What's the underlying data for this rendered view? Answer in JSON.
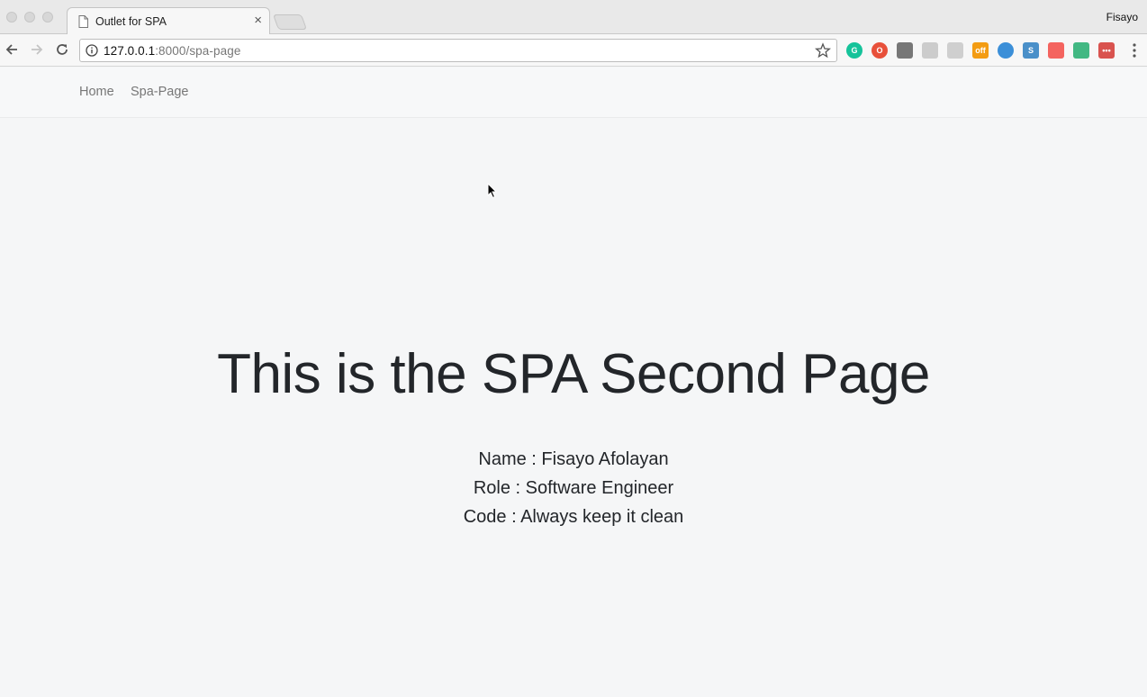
{
  "browser": {
    "tab_title": "Outlet for SPA",
    "tab_close": "×",
    "profile_name": "Fisayo",
    "url_host": "127.0.0.1",
    "url_rest": ":8000/spa-page",
    "extensions": [
      {
        "icon": "grammarly-icon",
        "color": "#15c39a",
        "glyph": "G"
      },
      {
        "icon": "opera-icon",
        "color": "#e8503a",
        "glyph": "O"
      },
      {
        "icon": "shield-icon",
        "color": "#777777",
        "glyph": ""
      },
      {
        "icon": "puzzle-icon",
        "color": "#cccccc",
        "glyph": ""
      },
      {
        "icon": "frame-icon",
        "color": "#cfcfcf",
        "glyph": ""
      },
      {
        "icon": "offline-icon",
        "color": "#f39c12",
        "glyph": "off"
      },
      {
        "icon": "globe-icon",
        "color": "#3b8fd8",
        "glyph": ""
      },
      {
        "icon": "s-icon",
        "color": "#4a90c9",
        "glyph": "S"
      },
      {
        "icon": "laravel-icon",
        "color": "#f4645f",
        "glyph": ""
      },
      {
        "icon": "vue-icon",
        "color": "#42b883",
        "glyph": ""
      },
      {
        "icon": "lastpass-icon",
        "color": "#d9534f",
        "glyph": "•••"
      }
    ]
  },
  "navbar": {
    "home": "Home",
    "spa_page": "Spa-Page"
  },
  "main": {
    "heading": "This is the SPA Second Page",
    "lines": [
      "Name : Fisayo Afolayan",
      "Role : Software Engineer",
      "Code : Always keep it clean"
    ]
  }
}
